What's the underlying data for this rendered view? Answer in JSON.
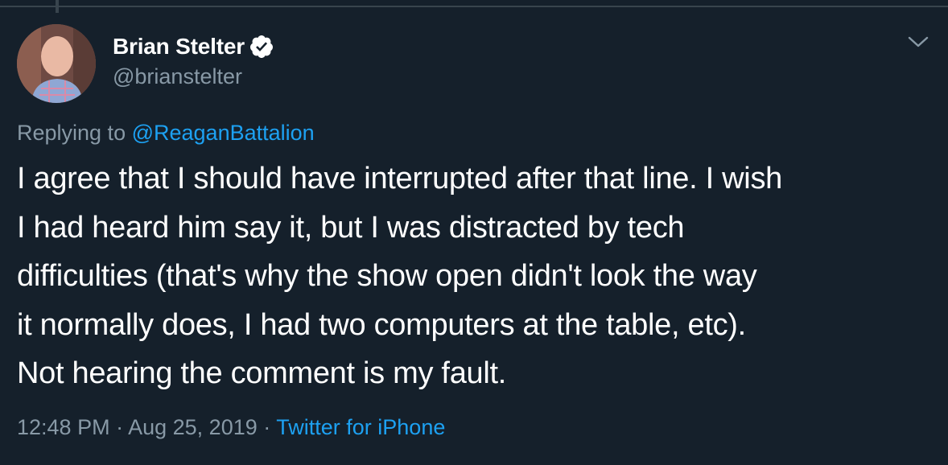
{
  "tweet": {
    "display_name": "Brian Stelter",
    "handle": "@brianstelter",
    "reply_prefix": "Replying to ",
    "reply_to": "@ReaganBattalion",
    "text_lines": [
      "I agree that I should have interrupted after that line. I wish",
      "I had heard him say it, but I was distracted by tech",
      "difficulties (that's why the show open didn't look the way",
      "it normally does, I had two computers at the table, etc).",
      "Not hearing the comment is my fault."
    ],
    "time": "12:48 PM",
    "separator": " · ",
    "date": "Aug 25, 2019",
    "source": "Twitter for iPhone"
  },
  "icons": {
    "verified": "verified-badge-icon",
    "menu": "chevron-down-icon"
  },
  "colors": {
    "background": "#15202b",
    "text_primary": "#ffffff",
    "text_secondary": "#8899a6",
    "accent": "#1da1f2",
    "border": "#38444d"
  }
}
